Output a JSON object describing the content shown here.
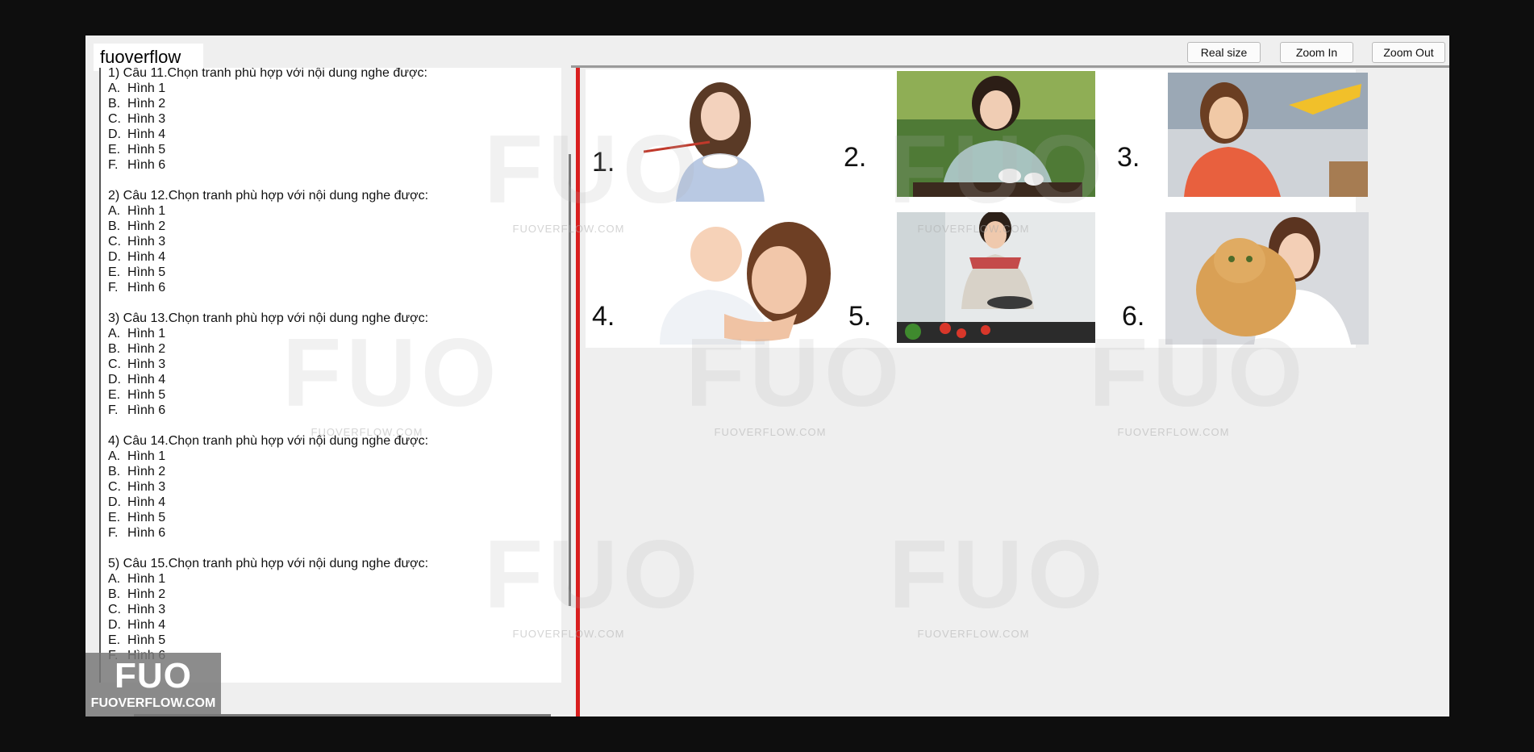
{
  "app": {
    "brand": "fuoverflow"
  },
  "toolbar": {
    "real_size": "Real size",
    "zoom_in": "Zoom In",
    "zoom_out": "Zoom Out"
  },
  "questions": [
    {
      "title": "1) Câu 11.Chọn tranh phù hợp với nội dung nghe được:",
      "options": [
        {
          "letter": "A.",
          "text": "Hình 1"
        },
        {
          "letter": "B.",
          "text": "Hình 2"
        },
        {
          "letter": "C.",
          "text": "Hình 3"
        },
        {
          "letter": "D.",
          "text": "Hình 4"
        },
        {
          "letter": "E.",
          "text": "Hình 5"
        },
        {
          "letter": "F.",
          "text": "Hình 6"
        }
      ]
    },
    {
      "title": "2) Câu 12.Chọn tranh phù hợp với nội dung nghe được:",
      "options": [
        {
          "letter": "A.",
          "text": "Hình 1"
        },
        {
          "letter": "B.",
          "text": "Hình 2"
        },
        {
          "letter": "C.",
          "text": "Hình 3"
        },
        {
          "letter": "D.",
          "text": "Hình 4"
        },
        {
          "letter": "E.",
          "text": "Hình 5"
        },
        {
          "letter": "F.",
          "text": "Hình 6"
        }
      ]
    },
    {
      "title": "3) Câu 13.Chọn tranh phù hợp với nội dung nghe được:",
      "options": [
        {
          "letter": "A.",
          "text": "Hình 1"
        },
        {
          "letter": "B.",
          "text": "Hình 2"
        },
        {
          "letter": "C.",
          "text": "Hình 3"
        },
        {
          "letter": "D.",
          "text": "Hình 4"
        },
        {
          "letter": "E.",
          "text": "Hình 5"
        },
        {
          "letter": "F.",
          "text": "Hình 6"
        }
      ]
    },
    {
      "title": "4) Câu 14.Chọn tranh phù hợp với nội dung nghe được:",
      "options": [
        {
          "letter": "A.",
          "text": "Hình 1"
        },
        {
          "letter": "B.",
          "text": "Hình 2"
        },
        {
          "letter": "C.",
          "text": "Hình 3"
        },
        {
          "letter": "D.",
          "text": "Hình 4"
        },
        {
          "letter": "E.",
          "text": "Hình 5"
        },
        {
          "letter": "F.",
          "text": "Hình 6"
        }
      ]
    },
    {
      "title": "5) Câu 15.Chọn tranh phù hợp với nội dung nghe được:",
      "options": [
        {
          "letter": "A.",
          "text": "Hình 1"
        },
        {
          "letter": "B.",
          "text": "Hình 2"
        },
        {
          "letter": "C.",
          "text": "Hình 3"
        },
        {
          "letter": "D.",
          "text": "Hình 4"
        },
        {
          "letter": "E.",
          "text": "Hình 5"
        },
        {
          "letter": "F.",
          "text": "Hình 6"
        }
      ]
    }
  ],
  "picture_labels": [
    "1.",
    "2.",
    "3.",
    "4.",
    "5.",
    "6."
  ],
  "watermark": {
    "mark": "FUO",
    "site": "FUOVERFLOW.COM"
  },
  "logo": {
    "mark": "FUO",
    "site": "FUOVERFLOW.COM"
  },
  "colors": {
    "splitter": "#d91f1f",
    "window_bg": "#efefef",
    "outer_bg": "#0e0e0e"
  }
}
